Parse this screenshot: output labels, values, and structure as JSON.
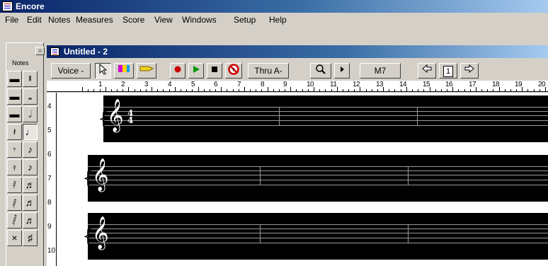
{
  "app": {
    "title": "Encore"
  },
  "menu": [
    "File",
    "Edit",
    "Notes",
    "Measures",
    "Score",
    "View",
    "Windows",
    "Setup",
    "Help"
  ],
  "palette": {
    "title": "Notes",
    "close_glyph": "×",
    "buttons": [
      [
        "▬",
        "𝄂"
      ],
      [
        "▬",
        "𝅝"
      ],
      [
        "▬",
        "𝅗𝅥"
      ],
      [
        "𝄽",
        "♩"
      ],
      [
        "𝄾",
        "♪"
      ],
      [
        "𝄿",
        "♪"
      ],
      [
        "𝅀",
        "♬"
      ],
      [
        "𝅁",
        "♬"
      ],
      [
        "𝅂",
        "♬"
      ],
      [
        "×",
        "♯"
      ]
    ]
  },
  "document": {
    "title": "Untitled - 2"
  },
  "toolbar": {
    "voice": "Voice -",
    "thru": "Thru A-",
    "chord": "M7",
    "page_number": "1",
    "record_color": "#cc0000",
    "play_color": "#009900"
  },
  "ruler": {
    "marks": [
      "1",
      "2",
      "3",
      "4",
      "5",
      "6",
      "7",
      "8",
      "9",
      "10",
      "11",
      "12",
      "13",
      "14",
      "15",
      "16",
      "17",
      "18",
      "19",
      "20"
    ]
  },
  "vruler": {
    "marks": [
      "4",
      "5",
      "6",
      "7",
      "8",
      "9",
      "10"
    ]
  },
  "score": {
    "time_signature": {
      "top": "4",
      "bottom": "4"
    },
    "clef_glyph": "𝄞",
    "brace_glyph": "{"
  }
}
